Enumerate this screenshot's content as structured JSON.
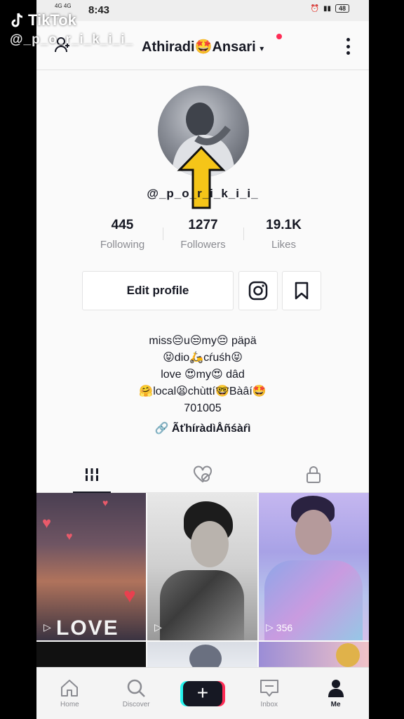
{
  "watermark": {
    "brand": "TikTok",
    "user": "@_p_o_r_i_k_i_i_"
  },
  "status_bar": {
    "time": "8:43",
    "net_left": "4G 4G",
    "battery": "48"
  },
  "header": {
    "title": "Athiradi🤩Ansari",
    "caret": "▾"
  },
  "profile": {
    "handle": "@_p_o_r_i_k_i_i_",
    "stats": [
      {
        "value": "445",
        "label": "Following"
      },
      {
        "value": "1277",
        "label": "Followers"
      },
      {
        "value": "19.1K",
        "label": "Likes"
      }
    ],
    "edit_label": "Edit profile",
    "bio": [
      "miss😔u😒my😔 päpä",
      "😝dio🛵cŕuśh😝",
      "love 😍my😍 dâd",
      "🤗local😫chùttí🤓Bàâí🤩",
      "701005"
    ],
    "link": "ÃťhíràdìÅñśàŕì"
  },
  "grid": {
    "video_views": [
      "",
      "",
      "356"
    ],
    "love_text": "LOVE"
  },
  "nav": [
    {
      "label": "Home"
    },
    {
      "label": "Discover"
    },
    {
      "label": ""
    },
    {
      "label": "Inbox"
    },
    {
      "label": "Me"
    }
  ],
  "colors": {
    "accent_red": "#fe2c55",
    "accent_cyan": "#25f4ee",
    "arrow_yellow": "#f5c518",
    "text": "#161823"
  }
}
